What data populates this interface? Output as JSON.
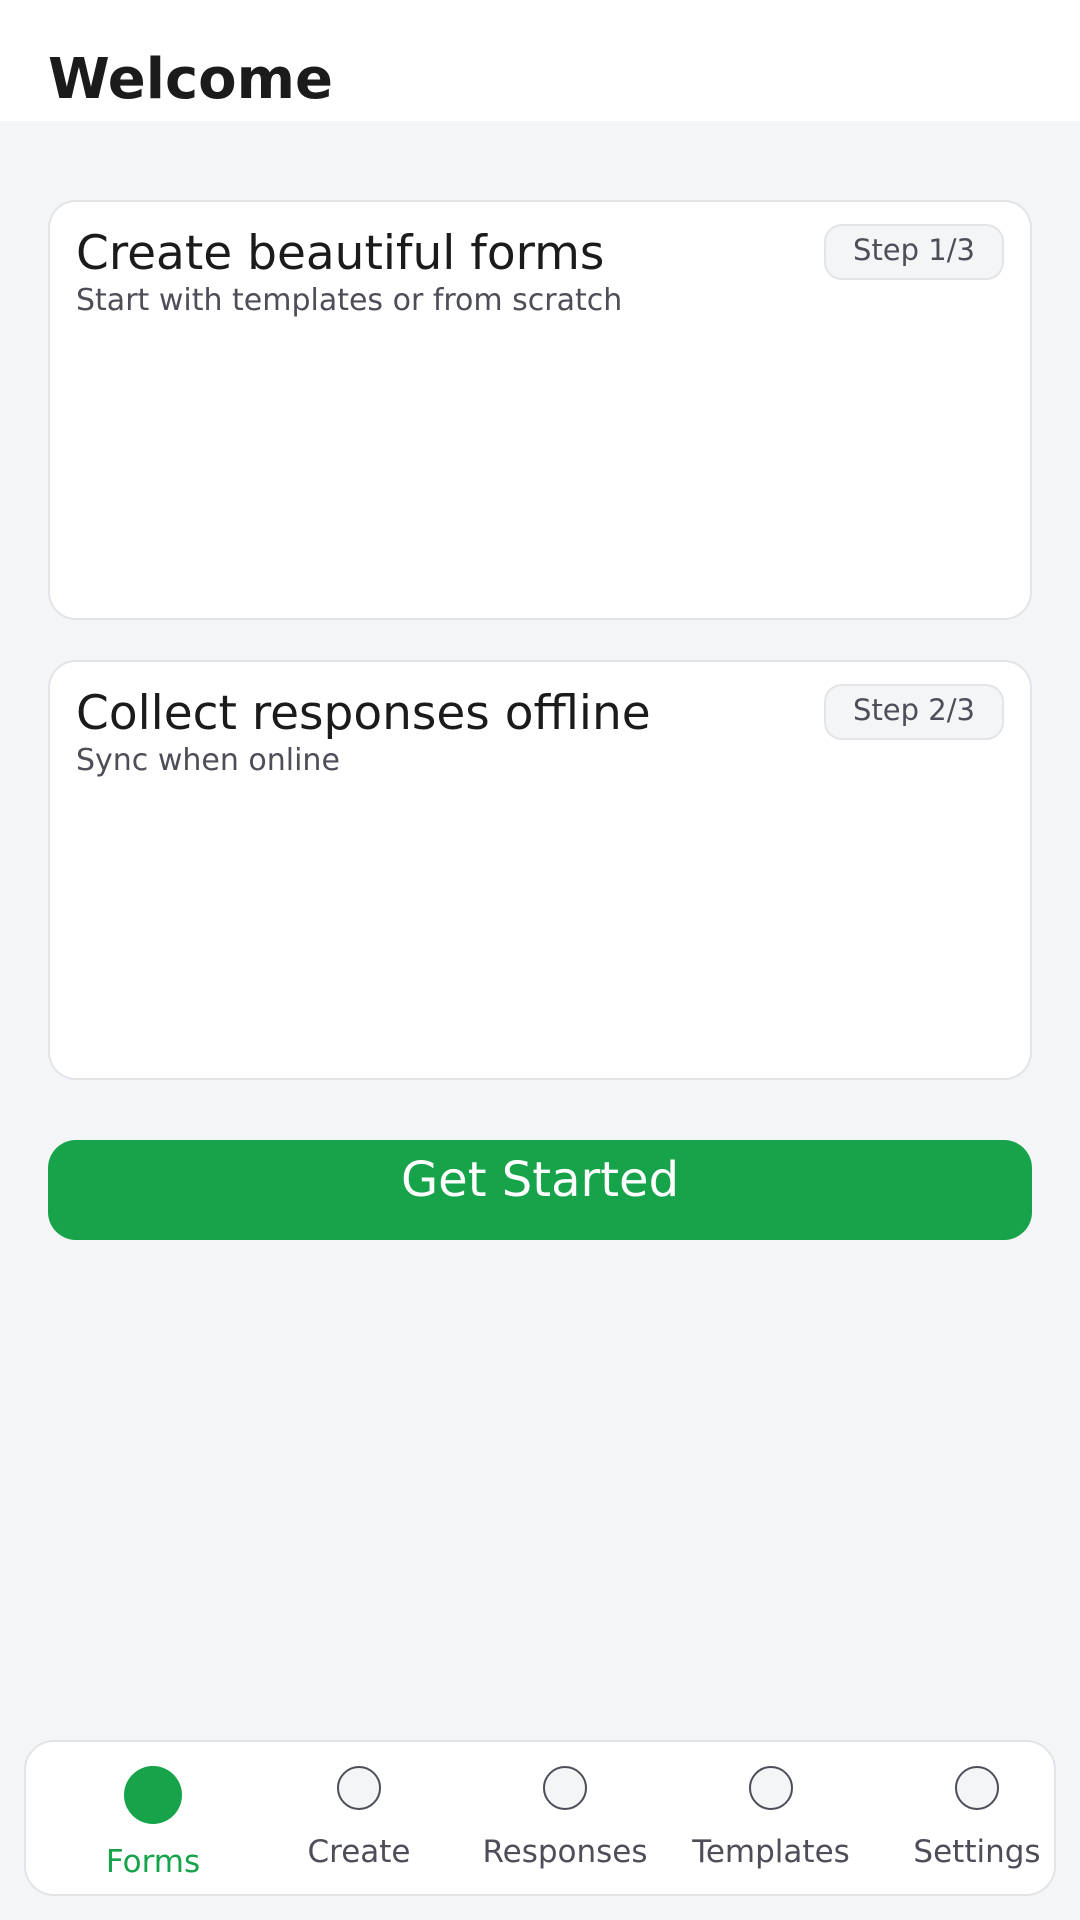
{
  "header": {
    "title": "Welcome"
  },
  "cards": [
    {
      "title": "Create beautiful forms",
      "subtitle": "Start with templates or from scratch",
      "step": "Step 1/3"
    },
    {
      "title": "Collect responses offline",
      "subtitle": "Sync when online",
      "step": "Step 2/3"
    }
  ],
  "cta": {
    "label": "Get Started"
  },
  "bottom_nav": {
    "items": [
      {
        "label": "Forms",
        "icon": "forms-icon",
        "active": true
      },
      {
        "label": "Create",
        "icon": "create-icon",
        "active": false
      },
      {
        "label": "Responses",
        "icon": "responses-icon",
        "active": false
      },
      {
        "label": "Templates",
        "icon": "templates-icon",
        "active": false
      },
      {
        "label": "Settings",
        "icon": "settings-icon",
        "active": false
      }
    ]
  },
  "colors": {
    "accent": "#17a34a",
    "background": "#f4f5f7",
    "surface": "#ffffff",
    "text_primary": "#1b1b1b",
    "text_secondary": "#4d4e58",
    "border": "#e3e4e8"
  }
}
